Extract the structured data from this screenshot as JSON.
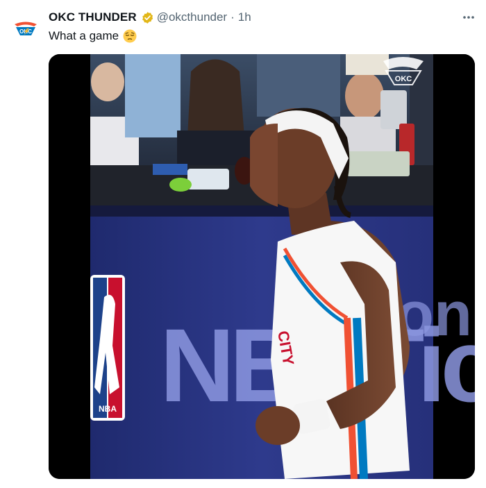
{
  "tweet": {
    "author_name": "OKC THUNDER",
    "handle": "@okcthunder",
    "separator": "·",
    "time": "1h",
    "text": "What a game",
    "emoji": "pensive-relieved-face"
  },
  "media": {
    "video_watermark": "OKC",
    "board_text": "NBATic",
    "board_text_right": "on",
    "nba_logo_text": "NBA",
    "jersey_text": "CITY"
  },
  "icons": {
    "avatar": "okc-thunder-logo",
    "verified": "verified-badge-icon",
    "more": "more-icon"
  },
  "colors": {
    "verified_gold": "#E2B719",
    "text_primary": "#0f1419",
    "text_secondary": "#536471",
    "jersey_orange": "#F05133",
    "jersey_blue": "#007AC1",
    "board_navy": "#2E3A8C"
  }
}
